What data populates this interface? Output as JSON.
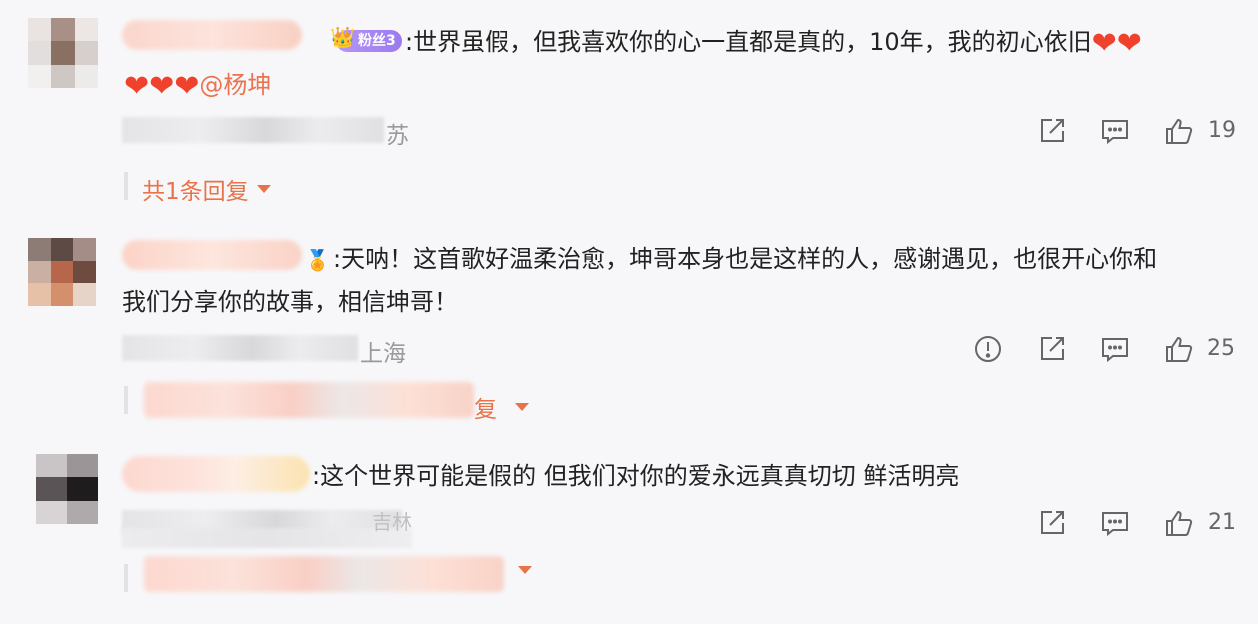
{
  "comments": [
    {
      "badge": "粉丝3",
      "text_line1": ":世界虽假，但我喜欢你的心一直都是真的，10年，我的初心依旧",
      "hearts_count_line1": 2,
      "hearts_count_line2": 3,
      "mention": "@杨坤",
      "location_tail": "苏",
      "likes": "19",
      "reply_label": "共1条回复"
    },
    {
      "text_line1": ":天呐！这首歌好温柔治愈，坤哥本身也是这样的人，感谢遇见，也很开心你和",
      "text_line2": "我们分享你的故事，相信坤哥！",
      "location_tail": "上海",
      "likes": "25",
      "reply_tail": "复"
    },
    {
      "text_line1": ":这个世界可能是假的 但我们对你的爱永远真真切切 鲜活明亮",
      "location_partial": "吉林",
      "likes": "21"
    }
  ],
  "icons": [
    "share-icon",
    "comment-icon",
    "like-icon",
    "report-icon",
    "caret-down-icon"
  ],
  "colors": {
    "accent": "#e8734a",
    "heart": "#f0412c",
    "background": "#f7f7f9"
  }
}
